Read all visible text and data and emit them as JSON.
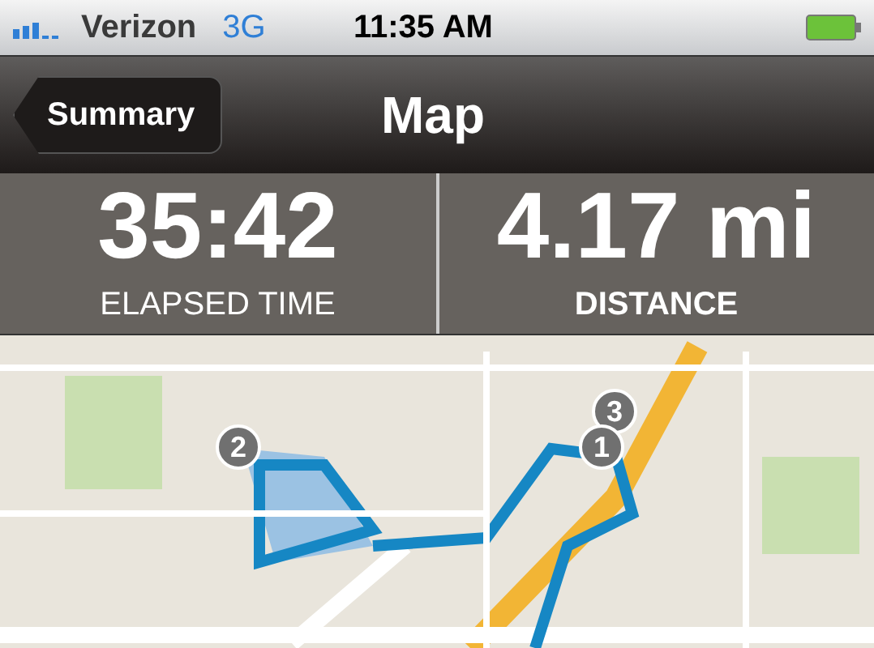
{
  "status_bar": {
    "carrier": "Verizon",
    "network": "3G",
    "time": "11:35 AM"
  },
  "nav_bar": {
    "back_button": "Summary",
    "title": "Map"
  },
  "stats": [
    {
      "value": "35:42",
      "label": "ELAPSED TIME"
    },
    {
      "value": "4.17 mi",
      "label": "DISTANCE"
    }
  ],
  "map": {
    "pins": [
      {
        "label": "2"
      },
      {
        "label": "3"
      },
      {
        "label": "1"
      }
    ]
  }
}
